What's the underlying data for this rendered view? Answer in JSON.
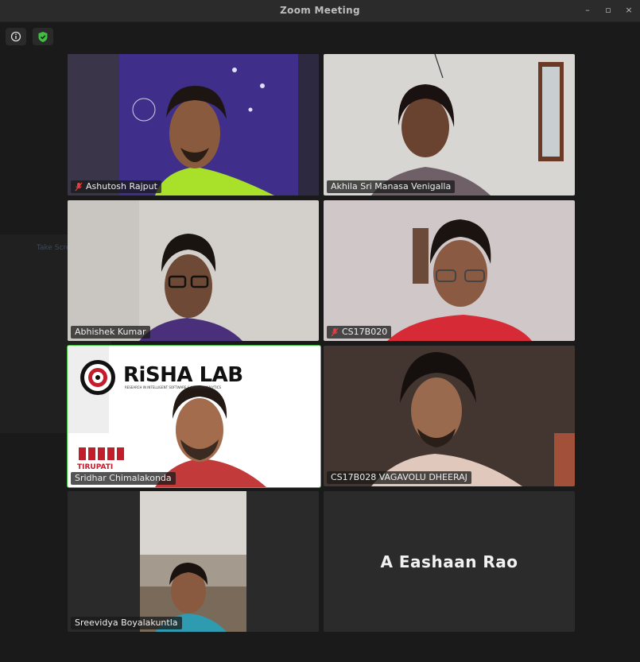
{
  "window": {
    "title": "Zoom Meeting",
    "controls": [
      "–",
      "▫",
      "×"
    ]
  },
  "toolbar": {
    "info_icon": "info-icon",
    "security_icon": "shield-check-icon"
  },
  "background_ghost": {
    "text": "Take Screenshot"
  },
  "participants": [
    {
      "name": "Ashutosh Rajput",
      "muted": true
    },
    {
      "name": "Akhila Sri Manasa Venigalla",
      "muted": false
    },
    {
      "name": "Abhishek Kumar",
      "muted": false
    },
    {
      "name": "CS17B020",
      "muted": true
    },
    {
      "name": "Sridhar Chimalakonda",
      "muted": false,
      "active_speaker": true,
      "virtual_background": {
        "logo": "RiSHA LAB",
        "tagline": "RESEARCH IN INTELLIGENT SOFTWARE & HUMAN ANALYTICS",
        "institute": "TIRUPATI"
      }
    },
    {
      "name": "CS17B028 VAGAVOLU DHEERAJ",
      "muted": false
    },
    {
      "name": "Sreevidya Boyalakuntla",
      "muted": false
    },
    {
      "name": "A Eashaan Rao",
      "muted": false,
      "video_off": true
    }
  ],
  "colors": {
    "active_speaker_border": "#3fc13f",
    "muted_icon": "#e04040",
    "security_icon": "#3fc13f"
  }
}
